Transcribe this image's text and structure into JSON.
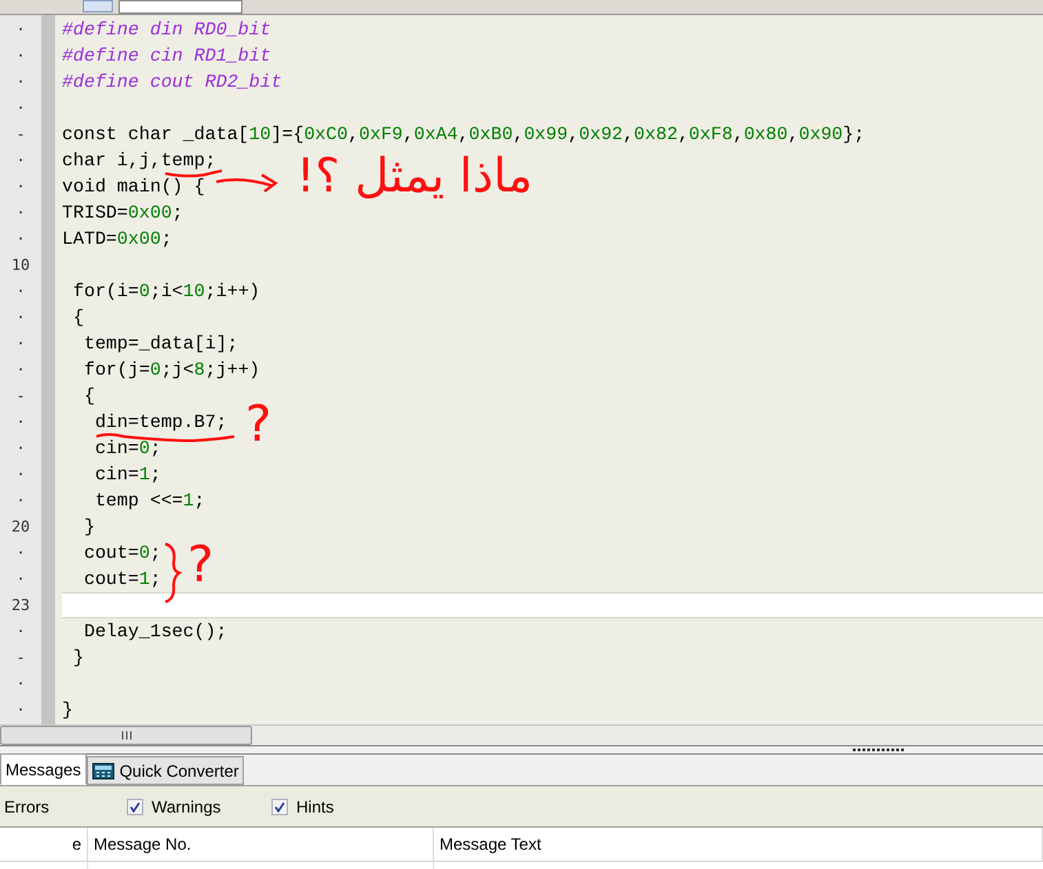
{
  "editor": {
    "lines": [
      {
        "gutter": "·",
        "current": false,
        "segments": [
          {
            "kind": "directive",
            "text": "#define din RD0_bit"
          }
        ]
      },
      {
        "gutter": "·",
        "current": false,
        "segments": [
          {
            "kind": "directive",
            "text": "#define cin RD1_bit"
          }
        ]
      },
      {
        "gutter": "·",
        "current": false,
        "segments": [
          {
            "kind": "directive",
            "text": "#define cout RD2_bit"
          }
        ]
      },
      {
        "gutter": "·",
        "current": false
      },
      {
        "gutter": "-",
        "current": false,
        "segments": [
          {
            "kind": "code",
            "text": "const char _data["
          },
          {
            "kind": "number",
            "text": "10"
          },
          {
            "kind": "code",
            "text": "]={"
          },
          {
            "kind": "number",
            "text": "0xC0"
          },
          {
            "kind": "code",
            "text": ","
          },
          {
            "kind": "number",
            "text": "0xF9"
          },
          {
            "kind": "code",
            "text": ","
          },
          {
            "kind": "number",
            "text": "0xA4"
          },
          {
            "kind": "code",
            "text": ","
          },
          {
            "kind": "number",
            "text": "0xB0"
          },
          {
            "kind": "code",
            "text": ","
          },
          {
            "kind": "number",
            "text": "0x99"
          },
          {
            "kind": "code",
            "text": ","
          },
          {
            "kind": "number",
            "text": "0x92"
          },
          {
            "kind": "code",
            "text": ","
          },
          {
            "kind": "number",
            "text": "0x82"
          },
          {
            "kind": "code",
            "text": ","
          },
          {
            "kind": "number",
            "text": "0xF8"
          },
          {
            "kind": "code",
            "text": ","
          },
          {
            "kind": "number",
            "text": "0x80"
          },
          {
            "kind": "code",
            "text": ","
          },
          {
            "kind": "number",
            "text": "0x90"
          },
          {
            "kind": "code",
            "text": "};"
          }
        ]
      },
      {
        "gutter": "·",
        "current": false,
        "segments": [
          {
            "kind": "code",
            "text": "char i,j,temp;"
          }
        ]
      },
      {
        "gutter": "·",
        "current": false,
        "segments": [
          {
            "kind": "code",
            "text": "void main() {"
          }
        ]
      },
      {
        "gutter": "·",
        "current": false,
        "segments": [
          {
            "kind": "code",
            "text": "TRISD="
          },
          {
            "kind": "number",
            "text": "0x00"
          },
          {
            "kind": "code",
            "text": ";"
          }
        ]
      },
      {
        "gutter": "·",
        "current": false,
        "segments": [
          {
            "kind": "code",
            "text": "LATD="
          },
          {
            "kind": "number",
            "text": "0x00"
          },
          {
            "kind": "code",
            "text": ";"
          }
        ]
      },
      {
        "gutter": "10",
        "current": false
      },
      {
        "gutter": "·",
        "current": false,
        "segments": [
          {
            "kind": "code",
            "text": " for(i="
          },
          {
            "kind": "number",
            "text": "0"
          },
          {
            "kind": "code",
            "text": ";i<"
          },
          {
            "kind": "number",
            "text": "10"
          },
          {
            "kind": "code",
            "text": ";i++)"
          }
        ]
      },
      {
        "gutter": "·",
        "current": false,
        "segments": [
          {
            "kind": "code",
            "text": " {"
          }
        ]
      },
      {
        "gutter": "·",
        "current": false,
        "segments": [
          {
            "kind": "code",
            "text": "  temp=_data[i];"
          }
        ]
      },
      {
        "gutter": "·",
        "current": false,
        "segments": [
          {
            "kind": "code",
            "text": "  for(j="
          },
          {
            "kind": "number",
            "text": "0"
          },
          {
            "kind": "code",
            "text": ";j<"
          },
          {
            "kind": "number",
            "text": "8"
          },
          {
            "kind": "code",
            "text": ";j++)"
          }
        ]
      },
      {
        "gutter": "-",
        "current": false,
        "segments": [
          {
            "kind": "code",
            "text": "  {"
          }
        ]
      },
      {
        "gutter": "·",
        "current": false,
        "segments": [
          {
            "kind": "code",
            "text": "   din=temp.B7;"
          }
        ]
      },
      {
        "gutter": "·",
        "current": false,
        "segments": [
          {
            "kind": "code",
            "text": "   cin="
          },
          {
            "kind": "number",
            "text": "0"
          },
          {
            "kind": "code",
            "text": ";"
          }
        ]
      },
      {
        "gutter": "·",
        "current": false,
        "segments": [
          {
            "kind": "code",
            "text": "   cin="
          },
          {
            "kind": "number",
            "text": "1"
          },
          {
            "kind": "code",
            "text": ";"
          }
        ]
      },
      {
        "gutter": "·",
        "current": false,
        "segments": [
          {
            "kind": "code",
            "text": "   temp <<="
          },
          {
            "kind": "number",
            "text": "1"
          },
          {
            "kind": "code",
            "text": ";"
          }
        ]
      },
      {
        "gutter": "20",
        "current": false,
        "segments": [
          {
            "kind": "code",
            "text": "  }"
          }
        ]
      },
      {
        "gutter": "·",
        "current": false,
        "segments": [
          {
            "kind": "code",
            "text": "  cout="
          },
          {
            "kind": "number",
            "text": "0"
          },
          {
            "kind": "code",
            "text": ";"
          }
        ]
      },
      {
        "gutter": "·",
        "current": false,
        "segments": [
          {
            "kind": "code",
            "text": "  cout="
          },
          {
            "kind": "number",
            "text": "1"
          },
          {
            "kind": "code",
            "text": ";"
          }
        ]
      },
      {
        "gutter": "23",
        "current": true
      },
      {
        "gutter": "·",
        "current": false,
        "segments": [
          {
            "kind": "code",
            "text": "  Delay_1sec();"
          }
        ]
      },
      {
        "gutter": "-",
        "current": false,
        "segments": [
          {
            "kind": "code",
            "text": " }"
          }
        ]
      },
      {
        "gutter": "·",
        "current": false
      },
      {
        "gutter": "·",
        "current": false,
        "segments": [
          {
            "kind": "code",
            "text": "}"
          }
        ]
      }
    ],
    "annotations": [
      {
        "text": "ماذا يمثل ؟!"
      },
      {
        "text": "?"
      },
      {
        "text": "?"
      }
    ]
  },
  "panel": {
    "tabs": [
      {
        "label": "Messages",
        "selected": true
      },
      {
        "label": "Quick Converter",
        "selected": false
      }
    ],
    "filters": [
      {
        "label": "Errors"
      },
      {
        "label": "Warnings",
        "checked": true
      },
      {
        "label": "Hints",
        "checked": true
      }
    ],
    "columns": [
      "e",
      "Message No.",
      "Message Text"
    ]
  }
}
